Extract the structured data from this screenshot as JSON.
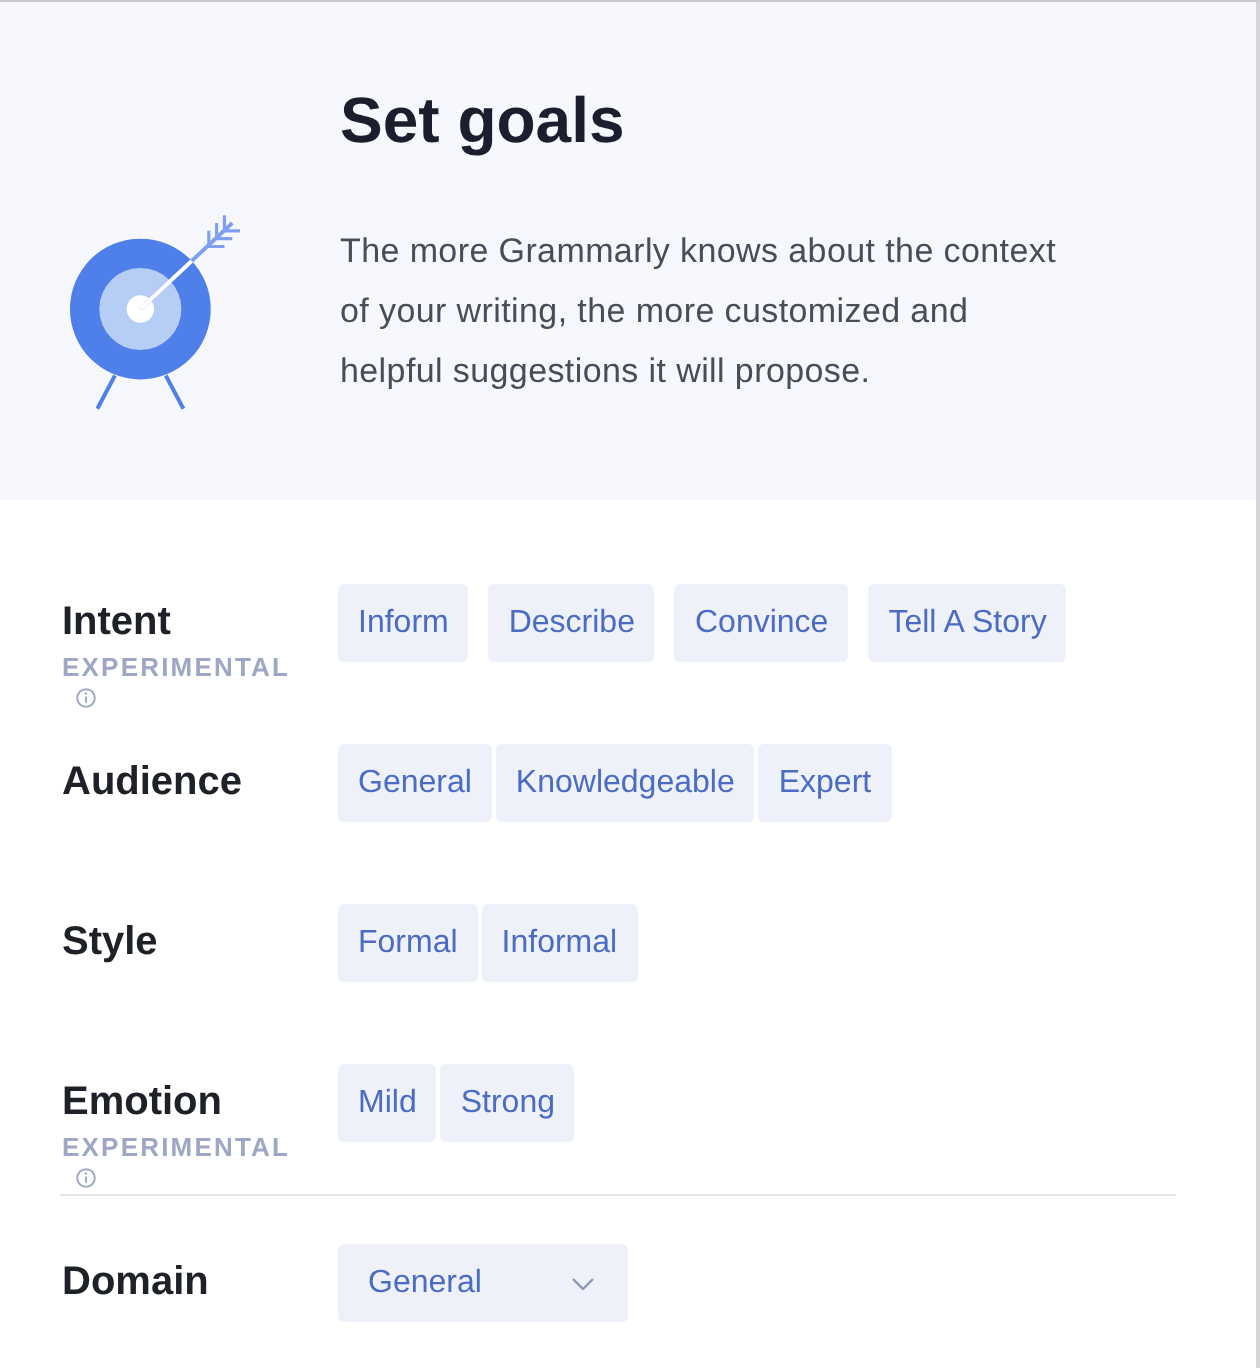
{
  "header": {
    "title": "Set goals",
    "description": "The more Grammarly knows about the context of your writing, the more customized and helpful suggestions it will propose."
  },
  "goals": [
    {
      "label": "Intent",
      "kind": "options",
      "note": "EXPERIMENTAL",
      "options": [
        {
          "label": "Inform",
          "selected": false
        },
        {
          "label": "Describe",
          "selected": false
        },
        {
          "label": "Convince",
          "selected": false
        },
        {
          "label": "Tell A Story",
          "selected": false
        }
      ]
    },
    {
      "label": "Audience",
      "kind": "options",
      "options": [
        {
          "label": "General",
          "selected": false
        },
        {
          "label": "Knowledgeable",
          "selected": false
        },
        {
          "label": "Expert",
          "selected": false
        }
      ]
    },
    {
      "label": "Style",
      "kind": "options",
      "options": [
        {
          "label": "Formal",
          "selected": false
        },
        {
          "label": "Informal",
          "selected": false
        }
      ]
    },
    {
      "label": "Emotion",
      "kind": "options",
      "note": "EXPERIMENTAL",
      "options": [
        {
          "label": "Mild",
          "selected": false
        },
        {
          "label": "Strong",
          "selected": false
        }
      ]
    },
    {
      "label": "Domain",
      "kind": "select",
      "value": "General"
    }
  ]
}
